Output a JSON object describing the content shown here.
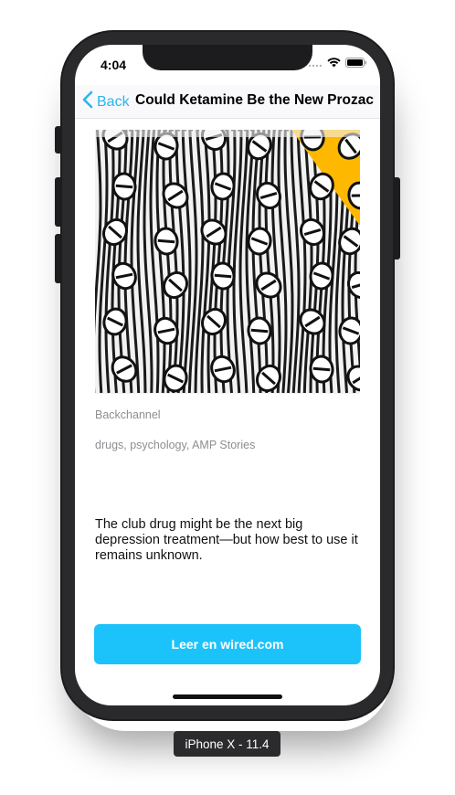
{
  "status_bar": {
    "time": "4:04"
  },
  "nav": {
    "back_label": "Back",
    "title": "Could Ketamine Be the New Prozac?"
  },
  "article": {
    "section": "Backchannel",
    "tags": "drugs, psychology, AMP Stories",
    "description": "The club drug might be the next big depression treatment—but how best to use it remains unknown.",
    "cta_label": "Leer en wired.com"
  },
  "device_label": "iPhone X - 11.4",
  "colors": {
    "accent": "#1cc3fb",
    "back": "#2bb5ee",
    "hero_yellow": "#ffb800"
  },
  "icons": [
    "signal-icon",
    "wifi-icon",
    "battery-icon",
    "chevron-left-icon"
  ]
}
